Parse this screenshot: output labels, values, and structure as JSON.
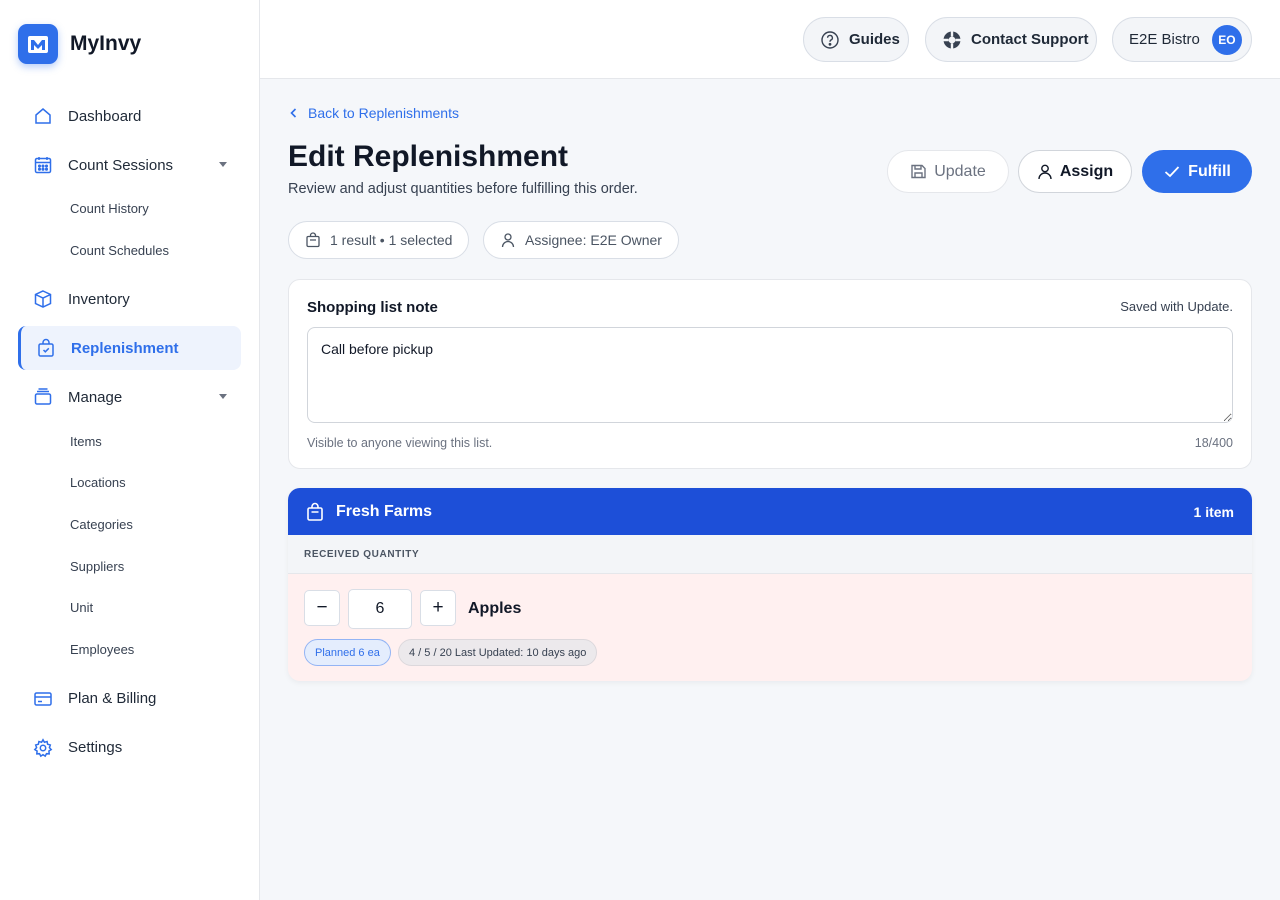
{
  "brand": {
    "name": "MyInvy",
    "accent": "#2f6fea"
  },
  "sidebar": {
    "items": [
      {
        "label": "Dashboard",
        "icon": "home-icon"
      },
      {
        "label": "Count Sessions",
        "icon": "calendar-icon",
        "expanded": true,
        "children": [
          {
            "label": "Count History"
          },
          {
            "label": "Count Schedules"
          }
        ]
      },
      {
        "label": "Inventory",
        "icon": "box-icon"
      },
      {
        "label": "Replenishment",
        "icon": "shopping-bag-icon",
        "active": true
      },
      {
        "label": "Manage",
        "icon": "layers-icon",
        "expanded": true,
        "children": [
          {
            "label": "Items"
          },
          {
            "label": "Locations"
          },
          {
            "label": "Categories"
          },
          {
            "label": "Suppliers"
          },
          {
            "label": "Unit"
          },
          {
            "label": "Employees"
          }
        ]
      },
      {
        "label": "Plan & Billing",
        "icon": "credit-card-icon"
      },
      {
        "label": "Settings",
        "icon": "gear-icon"
      }
    ]
  },
  "topbar": {
    "guides": "Guides",
    "support": "Contact Support",
    "account": "E2E Bistro",
    "avatar_initials": "EO"
  },
  "page": {
    "back_link": "Back to Replenishments",
    "title": "Edit Replenishment",
    "subtitle": "Review and adjust quantities before fulfilling this order.",
    "actions": {
      "update": "Update",
      "assign": "Assign",
      "fulfill": "Fulfill"
    },
    "chips": {
      "results": "1 result • 1 selected",
      "assignee": "Assignee: E2E Owner"
    }
  },
  "note_card": {
    "title": "Shopping list note",
    "saved_hint": "Saved with Update.",
    "value": "Call before pickup",
    "visibility": "Visible to anyone viewing this list.",
    "counter": "18/400"
  },
  "supplier": {
    "name": "Fresh Farms",
    "count": "1 item",
    "column": "RECEIVED QUANTITY",
    "header_color": "#1d4fd8",
    "rows": [
      {
        "minus": "−",
        "quantity": "6",
        "plus": "+",
        "name": "Apples",
        "planned": "Planned 6 ea",
        "stock": "4 / 5 / 20 Last Updated: 10 days ago"
      }
    ]
  }
}
